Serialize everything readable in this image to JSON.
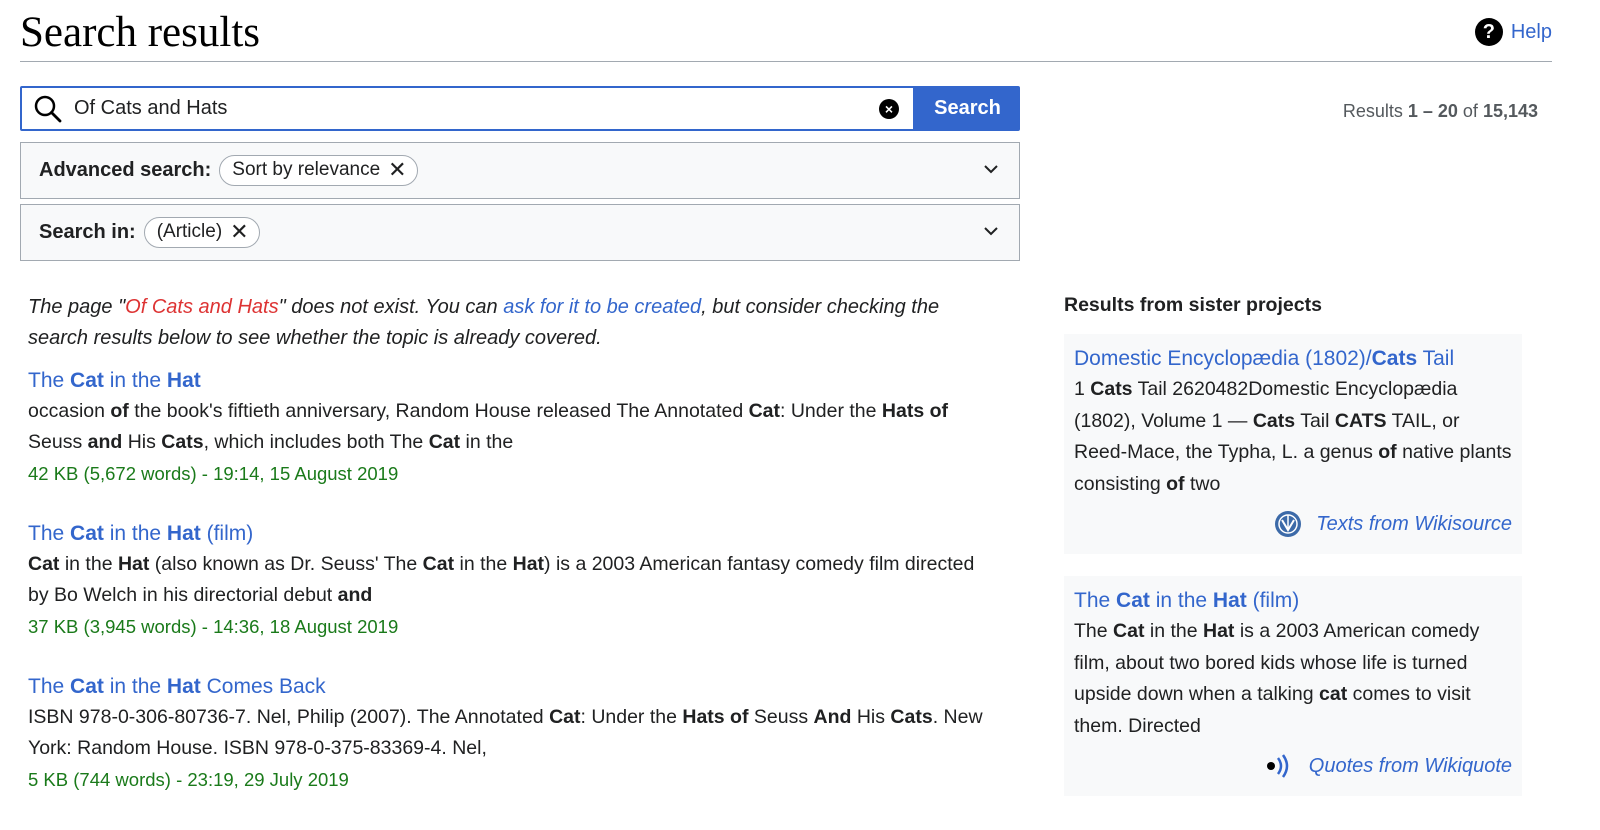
{
  "header": {
    "title": "Search results",
    "help_label": "Help",
    "help_icon_glyph": "?"
  },
  "search": {
    "value": "Of Cats and Hats",
    "clear_glyph": "×",
    "button_label": "Search"
  },
  "results_count": {
    "prefix": "Results ",
    "range": "1 – 20",
    "middle": " of ",
    "total": "15,143"
  },
  "advanced_search": {
    "label": "Advanced search:",
    "chip": "Sort by relevance",
    "chip_close": "✕"
  },
  "search_in": {
    "label": "Search in:",
    "chip": "(Article)",
    "chip_close": "✕"
  },
  "notice": {
    "part1": "The page \"",
    "redlink": "Of Cats and Hats",
    "part2": "\" does not exist. You can ",
    "bluelink": "ask for it to be created",
    "part3": ", but consider checking the search results below to see whether the topic is already covered."
  },
  "results": [
    {
      "title": [
        "The ",
        "Cat",
        " in the ",
        "Hat",
        ""
      ],
      "snippet": "occasion <b>of</b> the book's fiftieth anniversary, Random House released The Annotated <b>Cat</b>: Under the <b>Hats of</b> Seuss <b>and</b> His <b>Cats</b>, which includes both The <b>Cat</b> in the",
      "meta": "42 KB (5,672 words) - 19:14, 15 August 2019"
    },
    {
      "title": [
        "The ",
        "Cat",
        " in the ",
        "Hat",
        " (film)"
      ],
      "snippet": "<b>Cat</b> in the <b>Hat</b> (also known as Dr. Seuss' The <b>Cat</b> in the <b>Hat</b>) is a 2003 American fantasy comedy film directed by Bo Welch in his directorial debut <b>and</b>",
      "meta": "37 KB (3,945 words) - 14:36, 18 August 2019"
    },
    {
      "title": [
        "The ",
        "Cat",
        " in the ",
        "Hat",
        " Comes Back"
      ],
      "snippet": "ISBN 978-0-306-80736-7. Nel, Philip (2007). The Annotated <b>Cat</b>: Under the <b>Hats of</b> Seuss <b>And</b> His <b>Cats</b>. New York: Random House. ISBN 978-0-375-83369-4. Nel,",
      "meta": "5 KB (744 words) - 23:19, 29 July 2019"
    }
  ],
  "sister": {
    "heading": "Results from sister projects",
    "cards": [
      {
        "title": "Domestic Encyclopædia (1802)/<b>Cats</b> Tail",
        "snippet": "1 <b>Cats</b> Tail 2620482Domestic Encyclopædia (1802), Volume 1 — <b>Cats</b> Tail <b>CATS</b> TAIL, or Reed-Mace, the Typha, L. a genus <b>of</b> native plants consisting <b>of</b> two",
        "source": "Texts from Wikisource",
        "icon": "wikisource-icon"
      },
      {
        "title": "The <b>Cat</b> in the <b>Hat</b> (film)",
        "snippet": "The <b>Cat</b> in the <b>Hat</b> is a 2003 American comedy film, about two bored kids whose life is turned upside down when a talking <b>cat</b> comes to visit them. Directed",
        "source": "Quotes from Wikiquote",
        "icon": "wikiquote-icon"
      }
    ]
  },
  "colors": {
    "link": "#3366cc",
    "redlink": "#d33",
    "meta_green": "#1a7a1a",
    "border": "#a2a9b1"
  }
}
